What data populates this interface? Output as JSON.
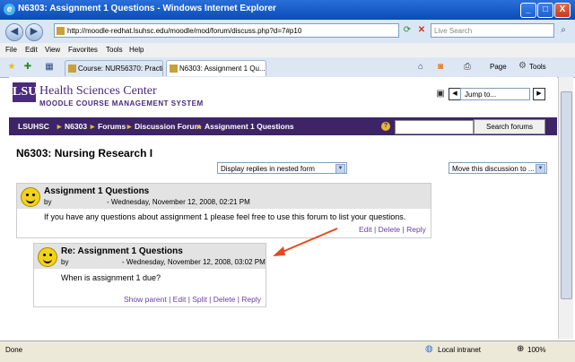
{
  "window": {
    "title": "N6303: Assignment 1 Questions - Windows Internet Explorer",
    "minimize": "_",
    "maximize": "□",
    "close": "X"
  },
  "addressbar": {
    "back": "◀",
    "forward": "▶",
    "url": "http://moodle-redhat.lsuhsc.edu/moodle/mod/forum/discuss.php?d=7#p10",
    "search_placeholder": "Live Search"
  },
  "menubar": [
    "File",
    "Edit",
    "View",
    "Favorites",
    "Tools",
    "Help"
  ],
  "tabs": [
    {
      "label": "Course: NUR56370: Practice ..."
    },
    {
      "label": "N6303: Assignment 1 Qu...",
      "active": true
    }
  ],
  "toolbar_right": {
    "page_label": "Page",
    "tools_label": "Tools"
  },
  "site": {
    "logo": "LSU",
    "name": "Health Sciences Center",
    "subtitle": "MOODLE COURSE MANAGEMENT SYSTEM",
    "jump_to": "Jump to..."
  },
  "breadcrumb": [
    "LSUHSC",
    "N6303",
    "Forums",
    "Discussion Forum",
    "Assignment 1 Questions"
  ],
  "search_forums_label": "Search forums",
  "page_title": "N6303: Nursing Research I",
  "display_mode": "Display replies in nested form",
  "move_discussion": "Move this discussion to ...",
  "posts": [
    {
      "subject": "Assignment 1 Questions",
      "by": "by",
      "date": "- Wednesday, November 12, 2008, 02:21 PM",
      "body": "If you have any questions about assignment 1 please feel free to use this forum to list your questions.",
      "links": [
        "Edit",
        "Delete",
        "Reply"
      ]
    },
    {
      "subject": "Re: Assignment 1 Questions",
      "by": "by",
      "date": "- Wednesday, November 12, 2008, 03:02 PM",
      "body": "When is assignment 1 due?",
      "links": [
        "Show parent",
        "Edit",
        "Split",
        "Delete",
        "Reply"
      ]
    }
  ],
  "statusbar": {
    "left": "Done",
    "zone": "Local intranet",
    "zoom": "100%"
  },
  "colors": {
    "navbar": "#3d2466",
    "link": "#6a3fa0",
    "arrow": "#e8471f"
  }
}
